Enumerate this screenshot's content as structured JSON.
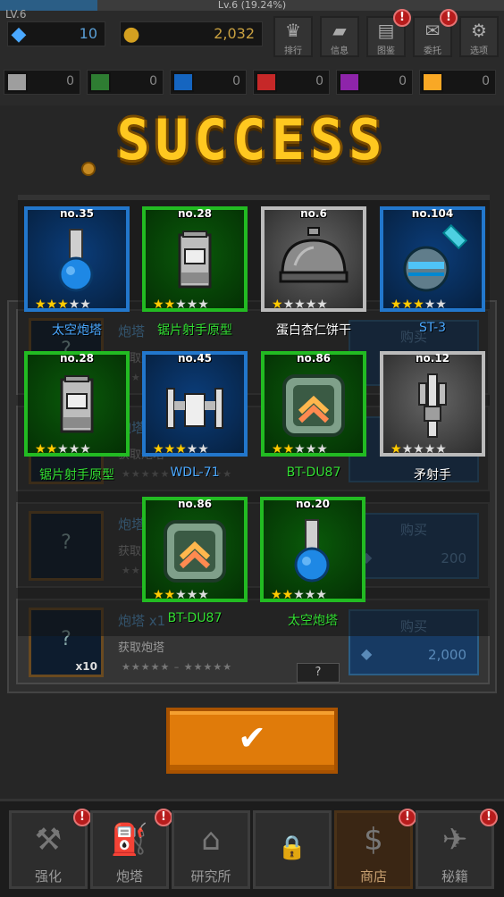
{
  "hud": {
    "level": "LV.6",
    "level_progress_text": "Lv.6 (19.24%)",
    "level_progress": 0.1924,
    "gems": "10",
    "coins": "2,032",
    "menu": [
      {
        "label": "排行",
        "icon": "trophy-icon",
        "badge": ""
      },
      {
        "label": "信息",
        "icon": "tablet-icon",
        "badge": ""
      },
      {
        "label": "图鉴",
        "icon": "book-icon",
        "badge": "!"
      },
      {
        "label": "委托",
        "icon": "scroll-icon",
        "badge": "!"
      },
      {
        "label": "选项",
        "icon": "gear-icon",
        "badge": ""
      }
    ],
    "parts": [
      {
        "color": "#9e9e9e",
        "value": "0"
      },
      {
        "color": "#2e7d32",
        "value": "0"
      },
      {
        "color": "#1565c0",
        "value": "0"
      },
      {
        "color": "#c62828",
        "value": "0"
      },
      {
        "color": "#8e24aa",
        "value": "0"
      },
      {
        "color": "#f9a825",
        "value": "0"
      }
    ]
  },
  "title": "SUCCESS",
  "rewards": [
    {
      "no": "no.35",
      "name": "太空炮塔",
      "rarity": "blue",
      "stars": 3,
      "art": "turret"
    },
    {
      "no": "no.28",
      "name": "锯片射手原型",
      "rarity": "green",
      "stars": 2,
      "art": "robot"
    },
    {
      "no": "no.6",
      "name": "蛋白杏仁饼干",
      "rarity": "white",
      "stars": 1,
      "art": "dome"
    },
    {
      "no": "no.104",
      "name": "ST-3",
      "rarity": "blue",
      "stars": 3,
      "art": "satellite"
    },
    {
      "no": "no.28",
      "name": "锯片射手原型",
      "rarity": "green",
      "stars": 2,
      "art": "robot"
    },
    {
      "no": "no.45",
      "name": "WDL-71",
      "rarity": "blue",
      "stars": 3,
      "art": "ship"
    },
    {
      "no": "no.86",
      "name": "BT-DU87",
      "rarity": "green",
      "stars": 2,
      "art": "chevron"
    },
    {
      "no": "no.12",
      "name": "矛射手",
      "rarity": "white",
      "stars": 1,
      "art": "spear"
    },
    {
      "no": "no.86",
      "name": "BT-DU87",
      "rarity": "green",
      "stars": 2,
      "art": "chevron"
    },
    {
      "no": "no.20",
      "name": "太空炮塔",
      "rarity": "green",
      "stars": 2,
      "art": "turret"
    }
  ],
  "shop": {
    "rows": [
      {
        "name": "炮塔",
        "desc": "获取炮塔",
        "price": "",
        "count": ""
      },
      {
        "name": "炮塔",
        "desc": "获取炮塔",
        "price": "",
        "count": ""
      },
      {
        "name": "炮塔",
        "desc": "获取",
        "price": "200",
        "count": ""
      },
      {
        "name": "炮塔 x1",
        "desc": "获取炮塔",
        "price": "2,000",
        "count": "x10"
      }
    ],
    "buy_label": "购买",
    "help_label": "?"
  },
  "confirm_label": "✔",
  "nav": [
    {
      "label": "强化",
      "icon": "wrench-icon",
      "badge": "!",
      "active": false
    },
    {
      "label": "炮塔",
      "icon": "turret-icon",
      "badge": "!",
      "active": false
    },
    {
      "label": "研究所",
      "icon": "lab-icon",
      "badge": "",
      "active": false
    },
    {
      "label": "",
      "icon": "lock-icon",
      "badge": "",
      "active": false
    },
    {
      "label": "商店",
      "icon": "money-bag-icon",
      "badge": "!",
      "active": true
    },
    {
      "label": "秘籍",
      "icon": "map-icon",
      "badge": "!",
      "active": false
    }
  ]
}
